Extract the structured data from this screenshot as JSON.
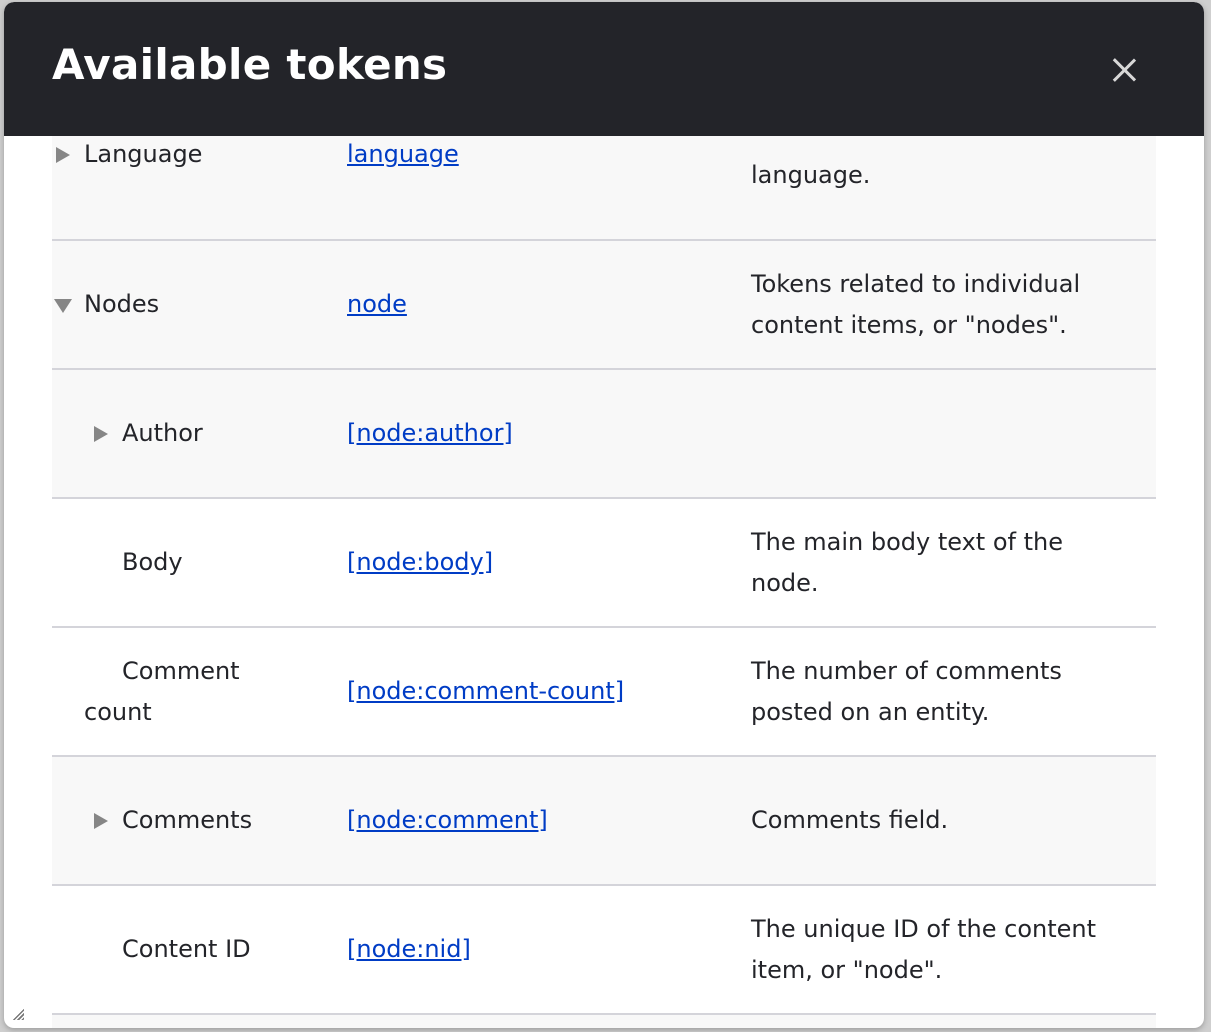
{
  "dialog": {
    "title": "Available tokens",
    "close_label": "Close"
  },
  "rows": [
    {
      "name": "Language",
      "token": "language",
      "description": "language.",
      "expander": "collapsed",
      "depth": 0
    },
    {
      "name": "Nodes",
      "token": "node",
      "description": "Tokens related to individual content items, or \"nodes\".",
      "expander": "expanded",
      "depth": 0
    },
    {
      "name": "Author",
      "token": "[node:author]",
      "description": "",
      "expander": "collapsed",
      "depth": 1
    },
    {
      "name": "Body",
      "token": "[node:body]",
      "description": "The main body text of the node.",
      "expander": "none",
      "depth": 1
    },
    {
      "name": "Comment count",
      "token": "[node:comment-count]",
      "description": "The number of comments posted on an entity.",
      "expander": "none",
      "depth": 1
    },
    {
      "name": "Comments",
      "token": "[node:comment]",
      "description": "Comments field.",
      "expander": "collapsed",
      "depth": 1
    },
    {
      "name": "Content ID",
      "token": "[node:nid]",
      "description": "The unique ID of the content item, or \"node\".",
      "expander": "none",
      "depth": 1
    }
  ],
  "colors": {
    "header": "#232429",
    "link": "#003cc5",
    "row_alt": "#f8f8f8"
  }
}
